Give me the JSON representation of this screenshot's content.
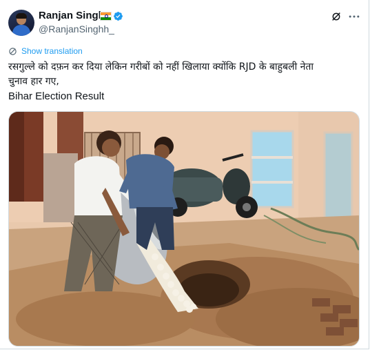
{
  "author": {
    "display_name": "Ranjan Singh",
    "handle": "@RanjanSinghh_",
    "flag_icon": "india-flag-icon",
    "verified_icon": "verified-badge-icon",
    "verified_color": "#1d9bf0"
  },
  "actions": {
    "grok_icon": "grok-icon",
    "more_icon": "more-horizontal-icon"
  },
  "translate": {
    "label": "Show translation",
    "icon": "translate-icon",
    "color": "#1d9bf0"
  },
  "tweet": {
    "line1": "रसगुल्ले को दफ़न कर दिया लेकिन गरीबों को नहीं खिलाया क्योंकि RJD के बाहुबली नेता",
    "line2": "चुनाव हार गए,",
    "line3": "Bihar Election Result"
  },
  "media": {
    "type": "photo"
  }
}
